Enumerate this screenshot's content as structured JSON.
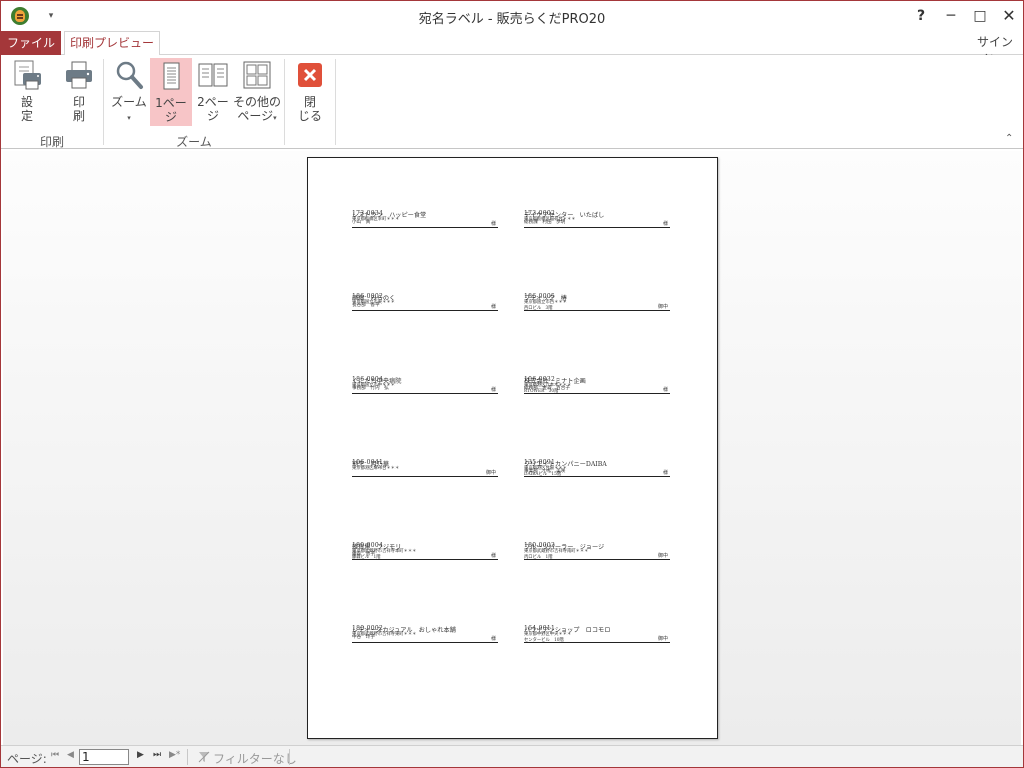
{
  "window": {
    "title": "宛名ラベル - 販売らくだPRO20",
    "help": "?",
    "minimize": "─",
    "maximize": "□",
    "close": "✕",
    "qat_dropdown": "▾"
  },
  "tabs": {
    "file": "ファイル",
    "print_preview": "印刷プレビュー",
    "signin": "サインイン"
  },
  "ribbon": {
    "setup": "設\n定",
    "print": "印\n刷",
    "zoom": "ズーム",
    "one_page": "1ペー\nジ",
    "two_page": "2ペー\nジ",
    "more_pages_line1": "その他の",
    "more_pages_line2": "ページ",
    "close": "閉\nじる",
    "group_print": "印刷",
    "group_zoom": "ズーム",
    "collapse": "⌃",
    "dropdown": "▾",
    "accent_close": "#e0503a",
    "accent_selected": "#f7c5c7"
  },
  "labels": [
    {
      "zip": "173-0034",
      "addr": "東京都板橋区幸町＊＊＊",
      "company": "",
      "person": "",
      "honor": ""
    },
    {
      "zip": "173-0002",
      "addr": "東京都板橋区稲荷台＊＊＊",
      "company": "",
      "person": "",
      "honor": ""
    },
    {
      "zip": "",
      "addr": "",
      "company": "レストラン　ハッピー食堂",
      "person": "小山　真",
      "honor": "様"
    },
    {
      "zip": "",
      "addr": "",
      "company": "デイケアセンター　いたばし",
      "person": "総務課　村田　歩明",
      "honor": "様"
    },
    {
      "zip": "186-0002",
      "addr": "東京都国立市東＊＊＊",
      "company": "",
      "person": "",
      "honor": ""
    },
    {
      "zip": "186-0005",
      "addr": "東京都国立市西＊＊＊\n西ロビル　3階",
      "company": "",
      "person": "",
      "honor": ""
    },
    {
      "zip": "",
      "addr": "",
      "company": "画廊　みらのく",
      "person": "長谷部　香平",
      "honor": "様"
    },
    {
      "zip": "",
      "addr": "",
      "company": "ブティック　椿",
      "person": "",
      "honor": "御中"
    },
    {
      "zip": "186-0004",
      "addr": "東京都国立市中＊＊＊",
      "company": "",
      "person": "",
      "honor": ""
    },
    {
      "zip": "106-0032",
      "addr": "東京都港区六本木＊＊＊\nRTOWER　30階",
      "company": "",
      "person": "",
      "honor": ""
    },
    {
      "zip": "",
      "addr": "",
      "company": "くにたち中央病院",
      "person": "事務部　竹内　弘",
      "honor": "様"
    },
    {
      "zip": "",
      "addr": "",
      "company": "株式会社　ミナト企画",
      "person": "総務部　金森　百合子",
      "honor": "様"
    },
    {
      "zip": "106-0041",
      "addr": "東京都港区麻布台＊＊＊",
      "company": "",
      "person": "",
      "honor": ""
    },
    {
      "zip": "135-0091",
      "addr": "東京都港区台場＊＊＊\nDAIBAビル　15階",
      "company": "",
      "person": "",
      "honor": ""
    },
    {
      "zip": "",
      "addr": "",
      "company": "割烹　月乃華",
      "person": "",
      "honor": "御中"
    },
    {
      "zip": "",
      "addr": "",
      "company": "クリエイトカンパニーDAIBA",
      "person": "事業部　小松　美咲",
      "honor": "様"
    },
    {
      "zip": "180-0004",
      "addr": "東京都武蔵野市吉祥寺本町＊＊＊\n藤森ビル　1階",
      "company": "",
      "person": "",
      "honor": ""
    },
    {
      "zip": "180-0003",
      "addr": "東京都武蔵野市吉祥寺南町＊＊＊\n丙ロビル　1階",
      "company": "",
      "person": "",
      "honor": ""
    },
    {
      "zip": "",
      "addr": "",
      "company": "雑貨屋　フジモリ",
      "person": "藤森　恵子",
      "honor": "様"
    },
    {
      "zip": "",
      "addr": "",
      "company": "フルーツパーラー　ジョージ",
      "person": "",
      "honor": "御中"
    },
    {
      "zip": "180-0002",
      "addr": "東京都武蔵野市吉祥寺東町＊＊＊",
      "company": "",
      "person": "",
      "honor": ""
    },
    {
      "zip": "164-0011",
      "addr": "東京都中野区中央＊＊＊\nセンタービル　10階",
      "company": "",
      "person": "",
      "honor": ""
    },
    {
      "zip": "",
      "addr": "",
      "company": "レディースカジュアル　おしゃれ本舗",
      "person": "中谷　玲子",
      "honor": "様"
    },
    {
      "zip": "",
      "addr": "",
      "company": "ハワイアンショップ　ロコモロ",
      "person": "",
      "honor": "御中"
    }
  ],
  "statusbar": {
    "page_label": "ページ:",
    "current_page": "1",
    "first": "⏮",
    "prev": "◀",
    "next": "▶",
    "last": "⏭",
    "new": "▶*",
    "filter_text": "フィルターなし"
  }
}
